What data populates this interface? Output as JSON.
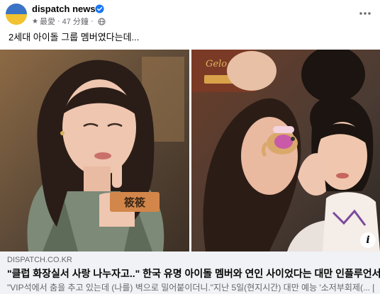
{
  "post": {
    "page_name": "dispatch news",
    "favorite_label": "最愛",
    "time": "47 分鐘",
    "separator": "·",
    "caption": "2세대 아이돌 그룹 멤버였다는데..."
  },
  "media": {
    "left_name_tag": "筱筱",
    "right_show_logo": "Gelo",
    "info_label": "i"
  },
  "link_preview": {
    "domain": "DISPATCH.CO.KR",
    "title": "\"클럽 화장실서 사랑 나누자고..\" 한국 유명 아이돌 멤버와 연인 사이었다는 대만 인플루언서",
    "description": "\"VIP석에서 춤을 추고 있는데 (나를) 벽으로 밀어붙이더니.\"지난 5일(현지시간) 대만 예능 '소저부회제(... [...]"
  },
  "colors": {
    "brand_yellow": "#f2c230",
    "brand_blue": "#3b73c6",
    "verified_blue": "#1877f2",
    "secondary_text": "#65676b",
    "link_box_bg": "#f0f2f5"
  },
  "icons": [
    "star-icon",
    "globe-icon",
    "verified-badge-icon",
    "more-options-icon",
    "info-icon"
  ]
}
